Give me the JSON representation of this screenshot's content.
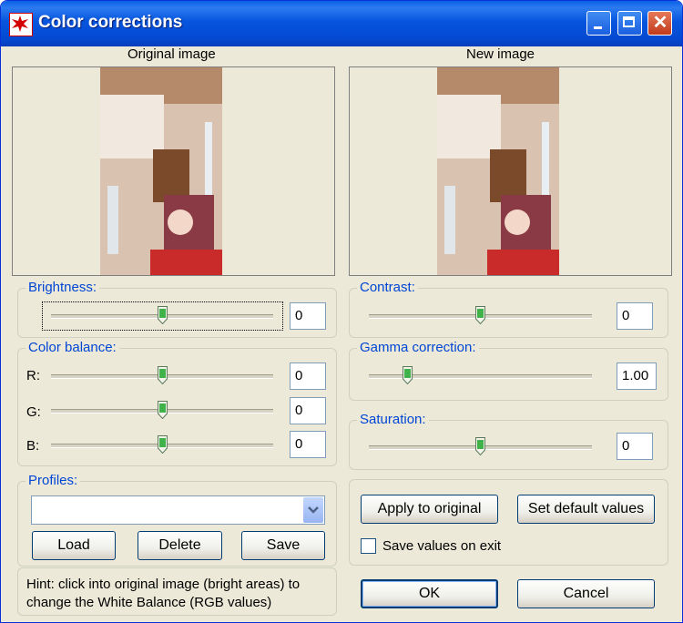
{
  "window": {
    "title": "Color corrections",
    "buttons": {
      "minimize": "minimize-icon",
      "maximize": "maximize-icon",
      "close": "close-icon"
    }
  },
  "preview": {
    "original_label": "Original image",
    "new_label": "New image"
  },
  "brightness": {
    "label": "Brightness:",
    "value": "0",
    "level": 0.5
  },
  "color_balance": {
    "label": "Color balance:",
    "r_label": "R:",
    "r_value": "0",
    "g_label": "G:",
    "g_value": "0",
    "b_label": "B:",
    "b_value": "0",
    "level": 0.5
  },
  "contrast": {
    "label": "Contrast:",
    "value": "0",
    "level": 0.5
  },
  "gamma": {
    "label": "Gamma correction:",
    "value": "1.00",
    "level": 0.16
  },
  "saturation": {
    "label": "Saturation:",
    "value": "0",
    "level": 0.5
  },
  "profiles": {
    "label": "Profiles:",
    "selected": "",
    "load": "Load",
    "delete": "Delete",
    "save": "Save"
  },
  "hint": {
    "line1": "Hint: click into original image (bright areas) to",
    "line2": "change the White Balance (RGB values)"
  },
  "actions": {
    "apply": "Apply to original",
    "defaults": "Set default values",
    "save_on_exit": "Save values on exit",
    "save_on_exit_checked": false,
    "ok": "OK",
    "cancel": "Cancel"
  },
  "colors": {
    "title_bar": "#0655de",
    "dialog_bg": "#ece9d8",
    "group_label": "#0046d5"
  }
}
